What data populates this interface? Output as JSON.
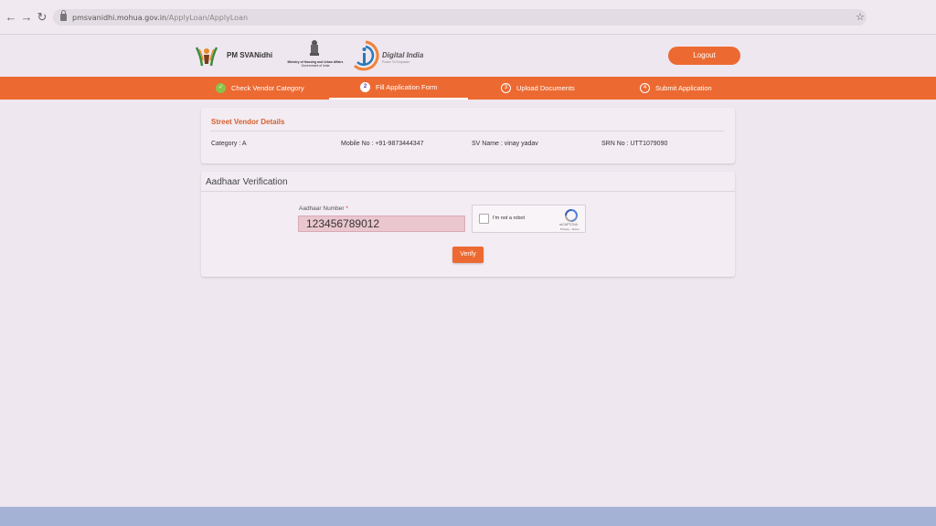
{
  "browser": {
    "url_host": "pmsvanidhi.mohua.gov.in",
    "url_path": "/ApplyLoan/ApplyLoan"
  },
  "header": {
    "brand_name": "PM SVANidhi",
    "ministry_line1": "Ministry of Housing and Urban Affairs",
    "ministry_line2": "Government of India",
    "digital_india": "Digital India",
    "digital_india_tagline": "Power To Empower",
    "logout_label": "Logout"
  },
  "steps": [
    {
      "number": "✓",
      "label": "Check Vendor Category",
      "state": "done"
    },
    {
      "number": "2",
      "label": "Fill Application Form",
      "state": "active"
    },
    {
      "number": "3",
      "label": "Upload Documents",
      "state": "pending"
    },
    {
      "number": "4",
      "label": "Submit Application",
      "state": "pending"
    }
  ],
  "vendor": {
    "title": "Street Vendor Details",
    "category": "Category : A",
    "mobile": "Mobile No : +91-9873444347",
    "name": "SV Name : vinay yadav",
    "srn": "SRN No : UTT1079090"
  },
  "aadhaar": {
    "title": "Aadhaar Verification",
    "label": "Aadhaar Number",
    "required_mark": "*",
    "value": "123456789012",
    "captcha_label": "I'm not a robot",
    "captcha_brand": "reCAPTCHA",
    "captcha_terms": "Privacy - Terms",
    "verify_label": "Verify"
  },
  "colors": {
    "accent": "#ec6a32",
    "step_done": "#8bc34a",
    "background": "#efe7ef",
    "footer": "#a4b2d6"
  }
}
